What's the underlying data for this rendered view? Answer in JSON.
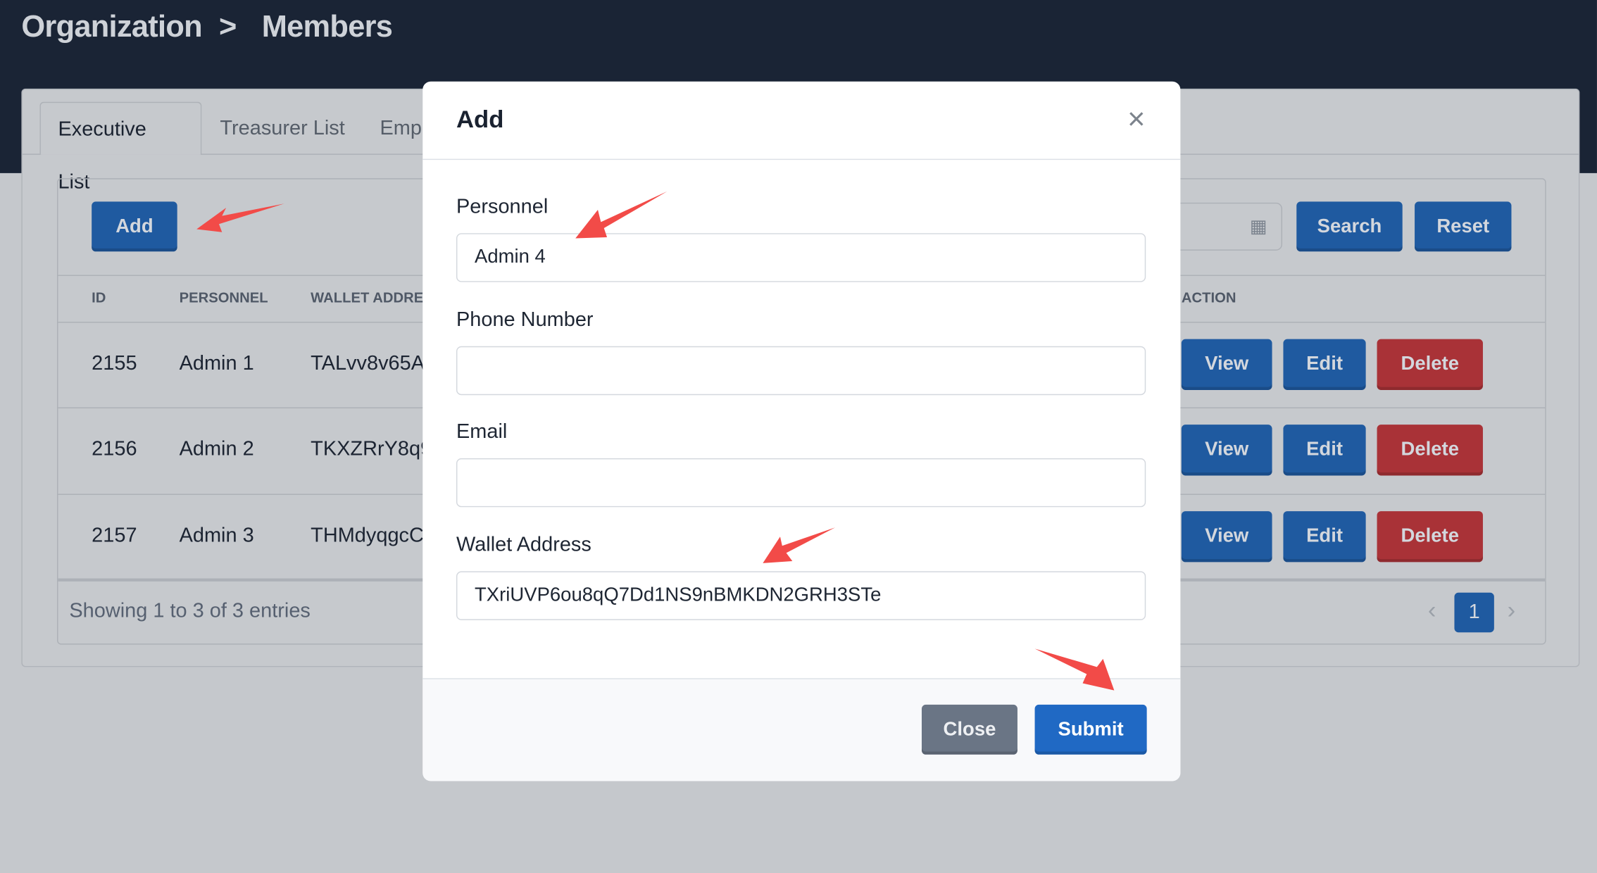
{
  "breadcrumb": {
    "parent": "Organization",
    "separator": ">",
    "current": "Members"
  },
  "tabs": [
    {
      "label": "Executive List",
      "active": true
    },
    {
      "label": "Treasurer List"
    },
    {
      "label": "Emp"
    }
  ],
  "toolbar": {
    "add_label": "Add",
    "search_label": "Search",
    "reset_label": "Reset",
    "date_icon": "calendar-icon"
  },
  "table": {
    "headers": [
      "ID",
      "PERSONNEL",
      "WALLET ADDRE",
      "ACTION"
    ],
    "rows": [
      {
        "id": "2155",
        "personnel": "Admin 1",
        "wallet": "TALvv8v65A",
        "view": "View",
        "edit": "Edit",
        "delete": "Delete"
      },
      {
        "id": "2156",
        "personnel": "Admin 2",
        "wallet": "TKXZRrY8q9",
        "view": "View",
        "edit": "Edit",
        "delete": "Delete"
      },
      {
        "id": "2157",
        "personnel": "Admin 3",
        "wallet": "THMdyqgcC",
        "view": "View",
        "edit": "Edit",
        "delete": "Delete"
      }
    ],
    "footer": "Showing 1 to 3 of 3 entries",
    "page": "1"
  },
  "modal": {
    "title": "Add",
    "fields": [
      {
        "label": "Personnel",
        "value": "Admin 4"
      },
      {
        "label": "Phone Number",
        "value": ""
      },
      {
        "label": "Email",
        "value": ""
      },
      {
        "label": "Wallet Address",
        "value": "TXriUVP6ou8qQ7Dd1NS9nBMKDN2GRH3STe"
      }
    ],
    "close_label": "Close",
    "submit_label": "Submit"
  },
  "colors": {
    "header": "#1a2435",
    "primary": "#1f5aa0",
    "danger": "#a93237",
    "submit": "#2069c4",
    "secondary": "#6a7585",
    "annotation_arrow": "#f24b48"
  }
}
